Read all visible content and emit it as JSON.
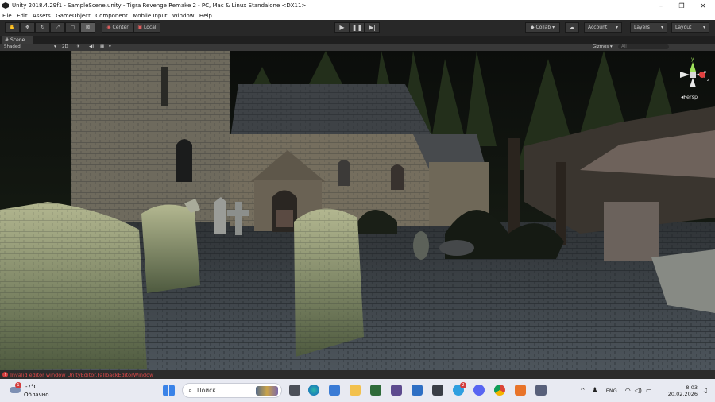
{
  "window": {
    "title": "Unity 2018.4.29f1 - SampleScene.unity - Tigra Revenge Remake 2 - PC, Mac & Linux Standalone <DX11>",
    "minimize": "–",
    "maximize": "❐",
    "close": "✕"
  },
  "menu": {
    "items": [
      "File",
      "Edit",
      "Assets",
      "GameObject",
      "Component",
      "Mobile Input",
      "Window",
      "Help"
    ]
  },
  "toolbar": {
    "pivot_label": "Center",
    "space_label": "Local",
    "collab_label": "Collab ▾",
    "account_label": "Account",
    "layers_label": "Layers",
    "layout_label": "Layout"
  },
  "scene": {
    "tab_label": "Scene",
    "shading_mode": "Shaded",
    "mode_2d": "2D",
    "gizmos_label": "Gizmos ▾",
    "search_placeholder": "All",
    "projection_label": "Persp"
  },
  "console": {
    "message": "Invalid editor window UnityEditor.FallbackEditorWindow"
  },
  "taskbar": {
    "temperature": "-7°C",
    "weather_text": "Облачно",
    "weather_badge": "1",
    "search_placeholder": "Поиск",
    "language": "ENG",
    "time": "8:03",
    "date": "20.02.2026",
    "telegram_badge": "2"
  },
  "colors": {
    "toolbar_bg": "#282828",
    "console_error": "#e04848",
    "taskbar_bg": "#e8eaf2"
  }
}
